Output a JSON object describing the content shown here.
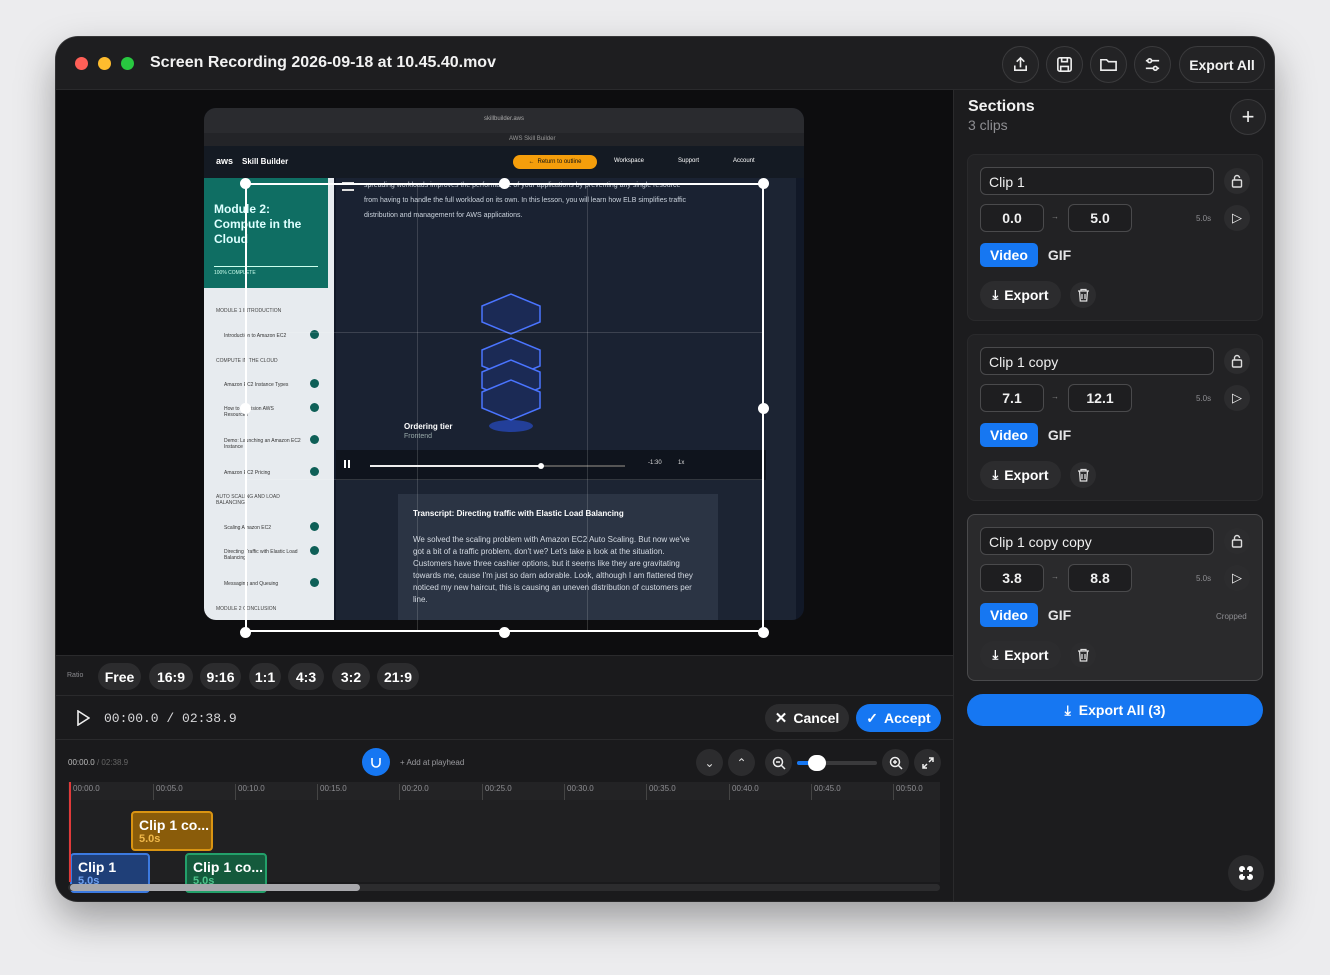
{
  "window": {
    "title": "Screen Recording 2026-09-18 at 10.45.40.mov",
    "export_all_label": "Export All",
    "toolbar_icons": [
      "share-icon",
      "save-icon",
      "folder-icon",
      "sliders-icon"
    ]
  },
  "recording": {
    "url": "skillbuilder.aws",
    "tab": "AWS Skill Builder",
    "brand": "Skill Builder",
    "return_btn": "Return to outline",
    "nav": [
      "Workspace",
      "Support",
      "Account"
    ],
    "module_title": "Module 2: Compute in the Cloud",
    "progress": "100% COMPLETE",
    "side_items": [
      "MODULE 1 INTRODUCTION",
      "Introduction to Amazon EC2",
      "COMPUTE IN THE CLOUD",
      "Amazon EC2 Instance Types",
      "How to Provision AWS Resources",
      "Demo: Launching an Amazon EC2 Instance",
      "Amazon EC2 Pricing",
      "AUTO SCALING AND LOAD BALANCING",
      "Scaling Amazon EC2",
      "Directing Traffic with Elastic Load Balancing",
      "Messaging and Queuing",
      "MODULE 2 CONCLUSION"
    ],
    "body_lines": [
      "spreading workloads improves the performance of your applications by preventing any single resource",
      "from having to handle the full workload on its own. In this lesson, you will learn how ELB simplifies traffic",
      "distribution and management for AWS applications."
    ],
    "tier_label": "Ordering tier",
    "tier_sub": "Frontend",
    "video_time": "-1:30",
    "video_speed": "1x",
    "transcript_title": "Transcript: Directing traffic with Elastic Load Balancing",
    "transcript_lines": [
      "We solved the scaling problem with Amazon EC2 Auto Scaling. But now we've",
      "got a bit of a traffic problem, don't we? Let's take a look at the situation.",
      "",
      "Customers have three cashier options, but it seems like they are gravitating",
      "towards me, cause I'm just so darn adorable. Look, although I am flattered they",
      "noticed my new haircut, this is causing an uneven distribution of customers per",
      "line."
    ]
  },
  "ratio": {
    "label": "Ratio",
    "options": [
      "Free",
      "16:9",
      "9:16",
      "1:1",
      "4:3",
      "3:2",
      "21:9"
    ],
    "selected": "Free"
  },
  "player": {
    "time": "00:00.0  /  02:38.9",
    "cancel": "Cancel",
    "accept": "Accept"
  },
  "timeline": {
    "current": "00:00.0",
    "total": "/ 02:38.9",
    "add_label": "+ Add at playhead",
    "zoom_level": 0.25,
    "ticks": [
      "00:00.0",
      "00:05.0",
      "00:10.0",
      "00:15.0",
      "00:20.0",
      "00:25.0",
      "00:30.0",
      "00:35.0",
      "00:40.0",
      "00:45.0",
      "00:50.0"
    ],
    "clips": [
      {
        "name": "Clip 1 co...",
        "dur": "5.0s",
        "color": "#c9860a"
      },
      {
        "name": "Clip 1",
        "dur": "5.0s",
        "color": "#2a5fb0"
      },
      {
        "name": "Clip 1 co...",
        "dur": "5.0s",
        "color": "#1f8a5a"
      }
    ]
  },
  "sections": {
    "title": "Sections",
    "count": "3 clips",
    "clips": [
      {
        "name": "Clip 1",
        "start": "0.0",
        "end": "5.0",
        "dur": "5.0s",
        "video": "Video",
        "gif": "GIF",
        "export": "Export",
        "note": ""
      },
      {
        "name": "Clip 1 copy",
        "start": "7.1",
        "end": "12.1",
        "dur": "5.0s",
        "video": "Video",
        "gif": "GIF",
        "export": "Export",
        "note": ""
      },
      {
        "name": "Clip 1 copy copy",
        "start": "3.8",
        "end": "8.8",
        "dur": "5.0s",
        "video": "Video",
        "gif": "GIF",
        "export": "Export",
        "note": "Cropped"
      }
    ],
    "export_all": "Export All (3)"
  },
  "colors": {
    "accent": "#1677f2",
    "bg": "#161618",
    "panel": "#1c1c1e"
  }
}
